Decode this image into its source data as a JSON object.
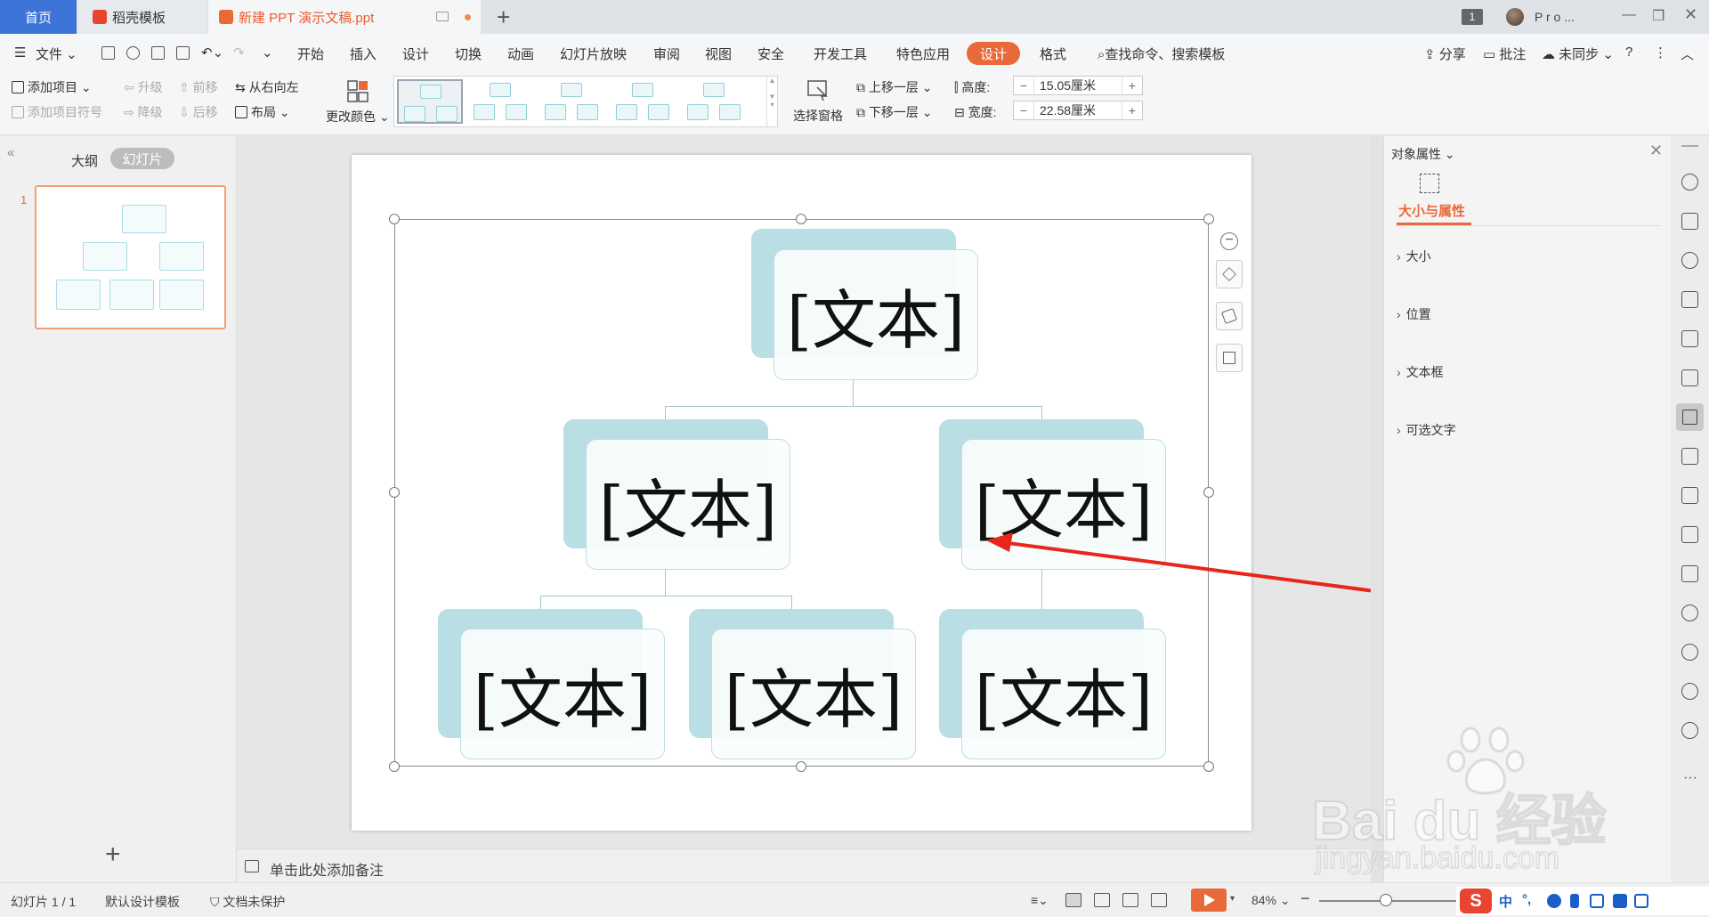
{
  "tabs": {
    "home": "首页",
    "template": "稻壳模板",
    "document": "新建 PPT 演示文稿.ppt",
    "badge": "1",
    "user": "P r o ..."
  },
  "menu": {
    "file": "文件",
    "items": [
      "开始",
      "插入",
      "设计",
      "切换",
      "动画",
      "幻灯片放映",
      "审阅",
      "视图",
      "安全",
      "开发工具",
      "特色应用"
    ],
    "active": "设计",
    "format": "格式",
    "search": "查找命令、搜索模板",
    "share": "分享",
    "comment": "批注",
    "sync": "未同步"
  },
  "ribbon": {
    "add_item": "添加项目",
    "add_bullet": "添加项目符号",
    "promote": "升级",
    "demote": "降级",
    "move_forward": "前移",
    "move_back": "后移",
    "rtl": "从右向左",
    "layout": "布局",
    "change_color": "更改颜色",
    "selection_pane": "选择窗格",
    "bring_forward": "上移一层",
    "send_backward": "下移一层",
    "height_label": "高度:",
    "height_value": "15.05厘米",
    "width_label": "宽度:",
    "width_value": "22.58厘米"
  },
  "left_panel": {
    "outline": "大纲",
    "slides": "幻灯片",
    "slide_number": "1"
  },
  "slide": {
    "nodes": [
      "[文本]",
      "[文本]",
      "[文本]",
      "[文本]",
      "[文本]",
      "[文本]"
    ]
  },
  "notes_placeholder": "单击此处添加备注",
  "right_pane": {
    "title": "对象属性",
    "tab": "大小与属性",
    "sections": [
      "大小",
      "位置",
      "文本框",
      "可选文字"
    ]
  },
  "status": {
    "slide_info": "幻灯片 1 / 1",
    "theme": "默认设计模板",
    "protection": "文档未保护",
    "zoom": "84%",
    "ime_lang": "中"
  },
  "colors": {
    "accent": "#e8693a",
    "node_back": "#b9dee3",
    "arrow": "#e8261c"
  },
  "watermark": {
    "brand": "Bai du 经验",
    "url": "jingyan.baidu.com"
  }
}
